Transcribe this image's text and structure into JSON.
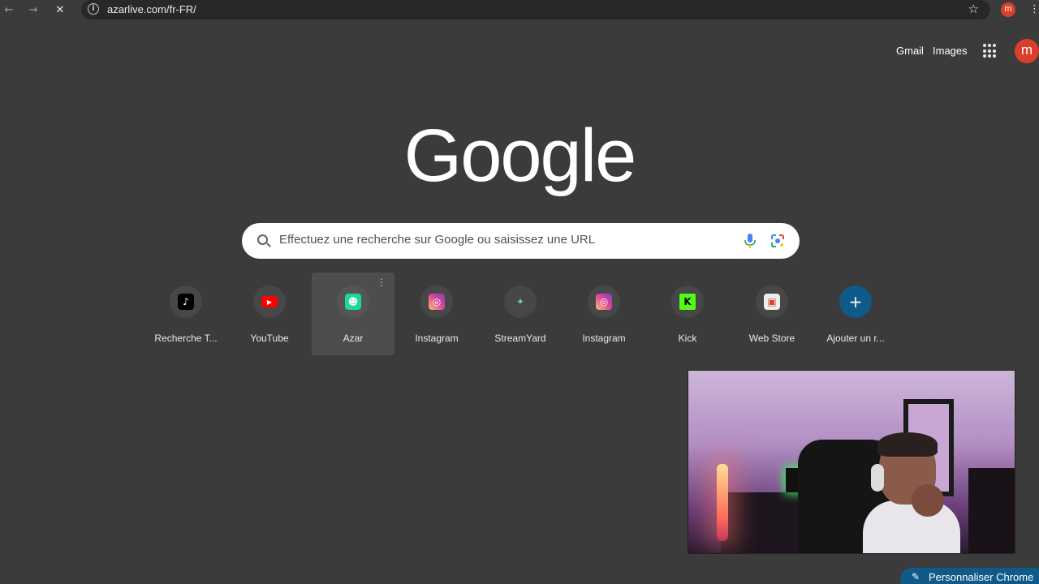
{
  "browser": {
    "url": "azarlive.com/fr-FR/",
    "back_icon": "←",
    "forward_icon": "→",
    "stop_icon": "✕",
    "info_icon": "i",
    "star_icon": "☆",
    "profile_initial": "m",
    "menu_icon": "⋮"
  },
  "header": {
    "gmail": "Gmail",
    "images": "Images",
    "avatar_initial": "m"
  },
  "logo": "Google",
  "search": {
    "placeholder": "Effectuez une recherche sur Google ou saisissez une URL"
  },
  "shortcuts": [
    {
      "label": "Recherche T...",
      "glyph": "♪"
    },
    {
      "label": "YouTube",
      "glyph": "▶"
    },
    {
      "label": "Azar",
      "glyph": "☻"
    },
    {
      "label": "Instagram",
      "glyph": "◎"
    },
    {
      "label": "StreamYard",
      "glyph": "✦"
    },
    {
      "label": "Instagram",
      "glyph": "◎"
    },
    {
      "label": "Kick",
      "glyph": "K"
    },
    {
      "label": "Web Store",
      "glyph": "▣"
    },
    {
      "label": "Ajouter un r...",
      "glyph": "+"
    }
  ],
  "shortcut_more_icon": "⋮",
  "customize": {
    "label": "Personnaliser Chrome",
    "icon": "✎"
  },
  "colors": {
    "background": "#3b3b3b",
    "accent": "#0f5a88",
    "avatar": "#d93f2a"
  }
}
